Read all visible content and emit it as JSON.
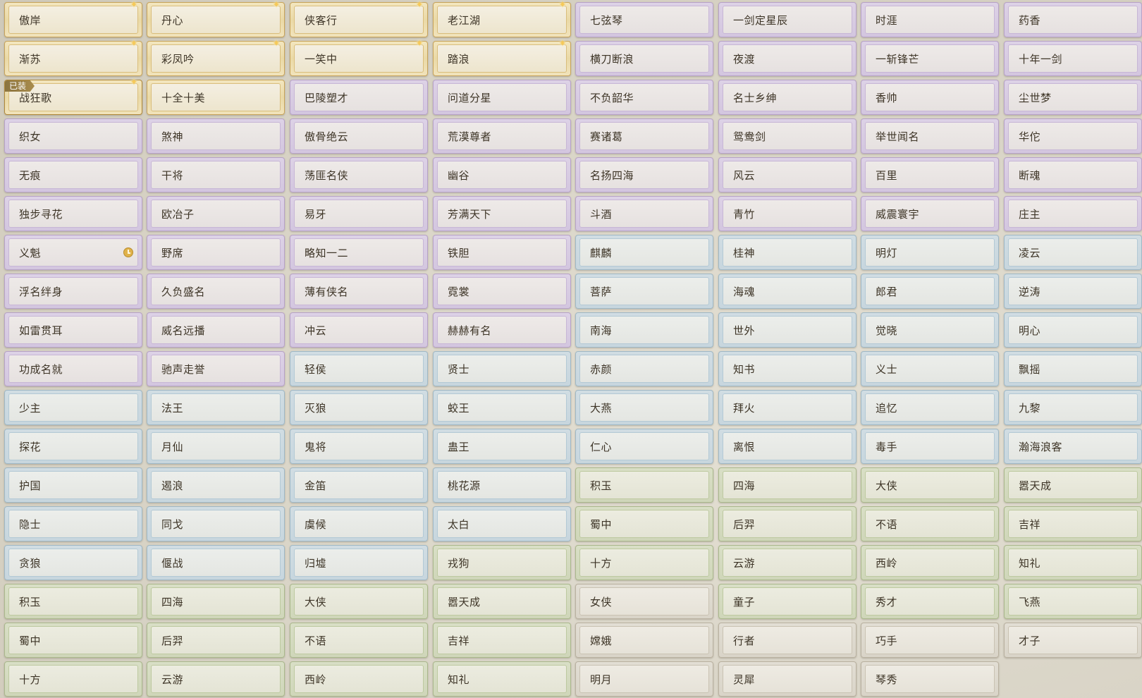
{
  "colors": {
    "gold": "#e9d6a0",
    "purple": "#d3c6df",
    "blue": "#c7d6de",
    "green": "#cfd6b9",
    "text": "#3d3426"
  },
  "equipped_badge": "已装",
  "columns": [
    [
      {
        "label": "傲岸",
        "tier": "gold",
        "sparkle": true
      },
      {
        "label": "渐苏",
        "tier": "gold",
        "sparkle": true
      },
      {
        "label": "战狂歌",
        "tier": "gold",
        "sparkle": true,
        "equipped": true
      },
      {
        "label": "织女",
        "tier": "purple"
      },
      {
        "label": "无痕",
        "tier": "purple"
      },
      {
        "label": "独步寻花",
        "tier": "purple"
      },
      {
        "label": "义魁",
        "tier": "purple",
        "timer": true
      },
      {
        "label": "浮名绊身",
        "tier": "purple"
      },
      {
        "label": "如雷贯耳",
        "tier": "purple"
      },
      {
        "label": "功成名就",
        "tier": "purple"
      },
      {
        "label": "少主",
        "tier": "blue"
      },
      {
        "label": "探花",
        "tier": "blue"
      },
      {
        "label": "护国",
        "tier": "blue"
      },
      {
        "label": "隐士",
        "tier": "blue"
      },
      {
        "label": "贪狼",
        "tier": "blue"
      },
      {
        "label": "积玉",
        "tier": "green"
      },
      {
        "label": "蜀中",
        "tier": "green"
      },
      {
        "label": "十方",
        "tier": "green"
      }
    ],
    [
      {
        "label": "丹心",
        "tier": "gold",
        "sparkle": true
      },
      {
        "label": "彩凤吟",
        "tier": "gold",
        "sparkle": true
      },
      {
        "label": "十全十美",
        "tier": "gold"
      },
      {
        "label": "煞神",
        "tier": "purple"
      },
      {
        "label": "干将",
        "tier": "purple"
      },
      {
        "label": "欧冶子",
        "tier": "purple"
      },
      {
        "label": "野席",
        "tier": "purple"
      },
      {
        "label": "久负盛名",
        "tier": "purple"
      },
      {
        "label": "威名远播",
        "tier": "purple"
      },
      {
        "label": "驰声走誉",
        "tier": "purple"
      },
      {
        "label": "法王",
        "tier": "blue"
      },
      {
        "label": "月仙",
        "tier": "blue"
      },
      {
        "label": "遏浪",
        "tier": "blue"
      },
      {
        "label": "同戈",
        "tier": "blue"
      },
      {
        "label": "偃战",
        "tier": "blue"
      },
      {
        "label": "四海",
        "tier": "green"
      },
      {
        "label": "后羿",
        "tier": "green"
      },
      {
        "label": "云游",
        "tier": "green"
      }
    ],
    [
      {
        "label": "侠客行",
        "tier": "gold",
        "sparkle": true
      },
      {
        "label": "一笑中",
        "tier": "gold",
        "sparkle": true
      },
      {
        "label": "巴陵塑才",
        "tier": "purple"
      },
      {
        "label": "傲骨绝云",
        "tier": "purple"
      },
      {
        "label": "荡匪名侠",
        "tier": "purple"
      },
      {
        "label": "易牙",
        "tier": "purple"
      },
      {
        "label": "略知一二",
        "tier": "purple"
      },
      {
        "label": "薄有侠名",
        "tier": "purple"
      },
      {
        "label": "冲云",
        "tier": "purple"
      },
      {
        "label": "轻侯",
        "tier": "blue"
      },
      {
        "label": "灭狼",
        "tier": "blue"
      },
      {
        "label": "鬼将",
        "tier": "blue"
      },
      {
        "label": "金笛",
        "tier": "blue"
      },
      {
        "label": "虞候",
        "tier": "blue"
      },
      {
        "label": "归墟",
        "tier": "blue"
      },
      {
        "label": "大侠",
        "tier": "green"
      },
      {
        "label": "不语",
        "tier": "green"
      },
      {
        "label": "西岭",
        "tier": "green"
      }
    ],
    [
      {
        "label": "老江湖",
        "tier": "gold",
        "sparkle": true
      },
      {
        "label": "踏浪",
        "tier": "gold",
        "sparkle": true
      },
      {
        "label": "问道分星",
        "tier": "purple"
      },
      {
        "label": "荒漠尊者",
        "tier": "purple"
      },
      {
        "label": "幽谷",
        "tier": "purple"
      },
      {
        "label": "芳满天下",
        "tier": "purple"
      },
      {
        "label": "铁胆",
        "tier": "purple"
      },
      {
        "label": "霓裳",
        "tier": "purple"
      },
      {
        "label": "赫赫有名",
        "tier": "purple"
      },
      {
        "label": "贤士",
        "tier": "blue"
      },
      {
        "label": "蛟王",
        "tier": "blue"
      },
      {
        "label": "蛊王",
        "tier": "blue"
      },
      {
        "label": "桃花源",
        "tier": "blue"
      },
      {
        "label": "太白",
        "tier": "blue"
      },
      {
        "label": "戎狗",
        "tier": "green"
      },
      {
        "label": "嚣天成",
        "tier": "green"
      },
      {
        "label": "吉祥",
        "tier": "green"
      },
      {
        "label": "知礼",
        "tier": "green"
      }
    ],
    [
      {
        "label": "七弦琴",
        "tier": "purple"
      },
      {
        "label": "横刀断浪",
        "tier": "purple"
      },
      {
        "label": "不负韶华",
        "tier": "purple"
      },
      {
        "label": "赛诸葛",
        "tier": "purple"
      },
      {
        "label": "名扬四海",
        "tier": "purple"
      },
      {
        "label": "斗酒",
        "tier": "purple"
      },
      {
        "label": "麒麟",
        "tier": "blue"
      },
      {
        "label": "菩萨",
        "tier": "blue"
      },
      {
        "label": "南海",
        "tier": "blue"
      },
      {
        "label": "赤颜",
        "tier": "blue"
      },
      {
        "label": "大燕",
        "tier": "blue"
      },
      {
        "label": "仁心",
        "tier": "blue"
      },
      {
        "label": "积玉",
        "tier": "green"
      },
      {
        "label": "蜀中",
        "tier": "green"
      },
      {
        "label": "十方",
        "tier": "green"
      },
      {
        "label": "女侠",
        "tier": "plain"
      },
      {
        "label": "嫦娥",
        "tier": "plain"
      },
      {
        "label": "明月",
        "tier": "plain"
      }
    ],
    [
      {
        "label": "一剑定星辰",
        "tier": "purple"
      },
      {
        "label": "夜渡",
        "tier": "purple"
      },
      {
        "label": "名士乡绅",
        "tier": "purple"
      },
      {
        "label": "鸳鸯剑",
        "tier": "purple"
      },
      {
        "label": "风云",
        "tier": "purple"
      },
      {
        "label": "青竹",
        "tier": "purple"
      },
      {
        "label": "桂神",
        "tier": "blue"
      },
      {
        "label": "海魂",
        "tier": "blue"
      },
      {
        "label": "世外",
        "tier": "blue"
      },
      {
        "label": "知书",
        "tier": "blue"
      },
      {
        "label": "拜火",
        "tier": "blue"
      },
      {
        "label": "离恨",
        "tier": "blue"
      },
      {
        "label": "四海",
        "tier": "green"
      },
      {
        "label": "后羿",
        "tier": "green"
      },
      {
        "label": "云游",
        "tier": "green"
      },
      {
        "label": "童子",
        "tier": "green"
      },
      {
        "label": "行者",
        "tier": "plain"
      },
      {
        "label": "灵犀",
        "tier": "plain"
      }
    ],
    [
      {
        "label": "时涯",
        "tier": "purple"
      },
      {
        "label": "一斩锋芒",
        "tier": "purple"
      },
      {
        "label": "香帅",
        "tier": "purple"
      },
      {
        "label": "举世闻名",
        "tier": "purple"
      },
      {
        "label": "百里",
        "tier": "purple"
      },
      {
        "label": "威震寰宇",
        "tier": "purple"
      },
      {
        "label": "明灯",
        "tier": "blue"
      },
      {
        "label": "郎君",
        "tier": "blue"
      },
      {
        "label": "觉晓",
        "tier": "blue"
      },
      {
        "label": "义士",
        "tier": "blue"
      },
      {
        "label": "追忆",
        "tier": "blue"
      },
      {
        "label": "毒手",
        "tier": "blue"
      },
      {
        "label": "大侠",
        "tier": "green"
      },
      {
        "label": "不语",
        "tier": "green"
      },
      {
        "label": "西岭",
        "tier": "green"
      },
      {
        "label": "秀才",
        "tier": "green"
      },
      {
        "label": "巧手",
        "tier": "plain"
      },
      {
        "label": "琴秀",
        "tier": "plain"
      }
    ],
    [
      {
        "label": "药香",
        "tier": "purple"
      },
      {
        "label": "十年一剑",
        "tier": "purple"
      },
      {
        "label": "尘世梦",
        "tier": "purple"
      },
      {
        "label": "华佗",
        "tier": "purple"
      },
      {
        "label": "断魂",
        "tier": "purple"
      },
      {
        "label": "庄主",
        "tier": "purple"
      },
      {
        "label": "凌云",
        "tier": "blue"
      },
      {
        "label": "逆涛",
        "tier": "blue"
      },
      {
        "label": "明心",
        "tier": "blue"
      },
      {
        "label": "飘摇",
        "tier": "blue"
      },
      {
        "label": "九黎",
        "tier": "blue"
      },
      {
        "label": "瀚海浪客",
        "tier": "blue"
      },
      {
        "label": "嚣天成",
        "tier": "green"
      },
      {
        "label": "吉祥",
        "tier": "green"
      },
      {
        "label": "知礼",
        "tier": "green"
      },
      {
        "label": "飞燕",
        "tier": "green"
      },
      {
        "label": "才子",
        "tier": "plain"
      }
    ]
  ]
}
